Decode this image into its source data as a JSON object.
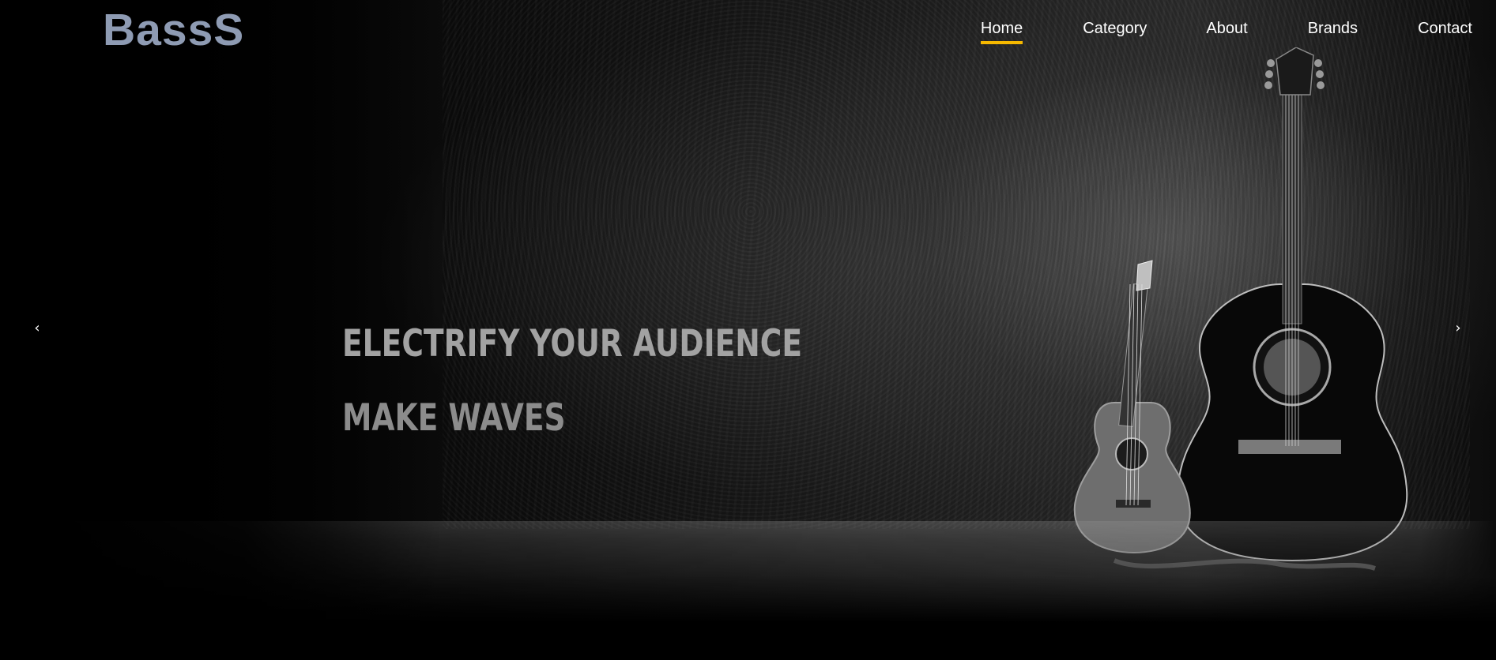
{
  "brand": {
    "logo_text": "BassS",
    "logo_color": "#8e9bb3"
  },
  "nav": {
    "items": [
      {
        "label": "Home",
        "active": true
      },
      {
        "label": "Category",
        "active": false
      },
      {
        "label": "About",
        "active": false
      },
      {
        "label": "Brands",
        "active": false
      },
      {
        "label": "Contact",
        "active": false
      }
    ],
    "active_underline_color": "#f5b800"
  },
  "hero": {
    "headline_1": "ELECTRIFY YOUR AUDIENCE",
    "headline_2": "MAKE WAVES"
  },
  "carousel": {
    "prev_icon": "‹",
    "next_icon": "›"
  }
}
